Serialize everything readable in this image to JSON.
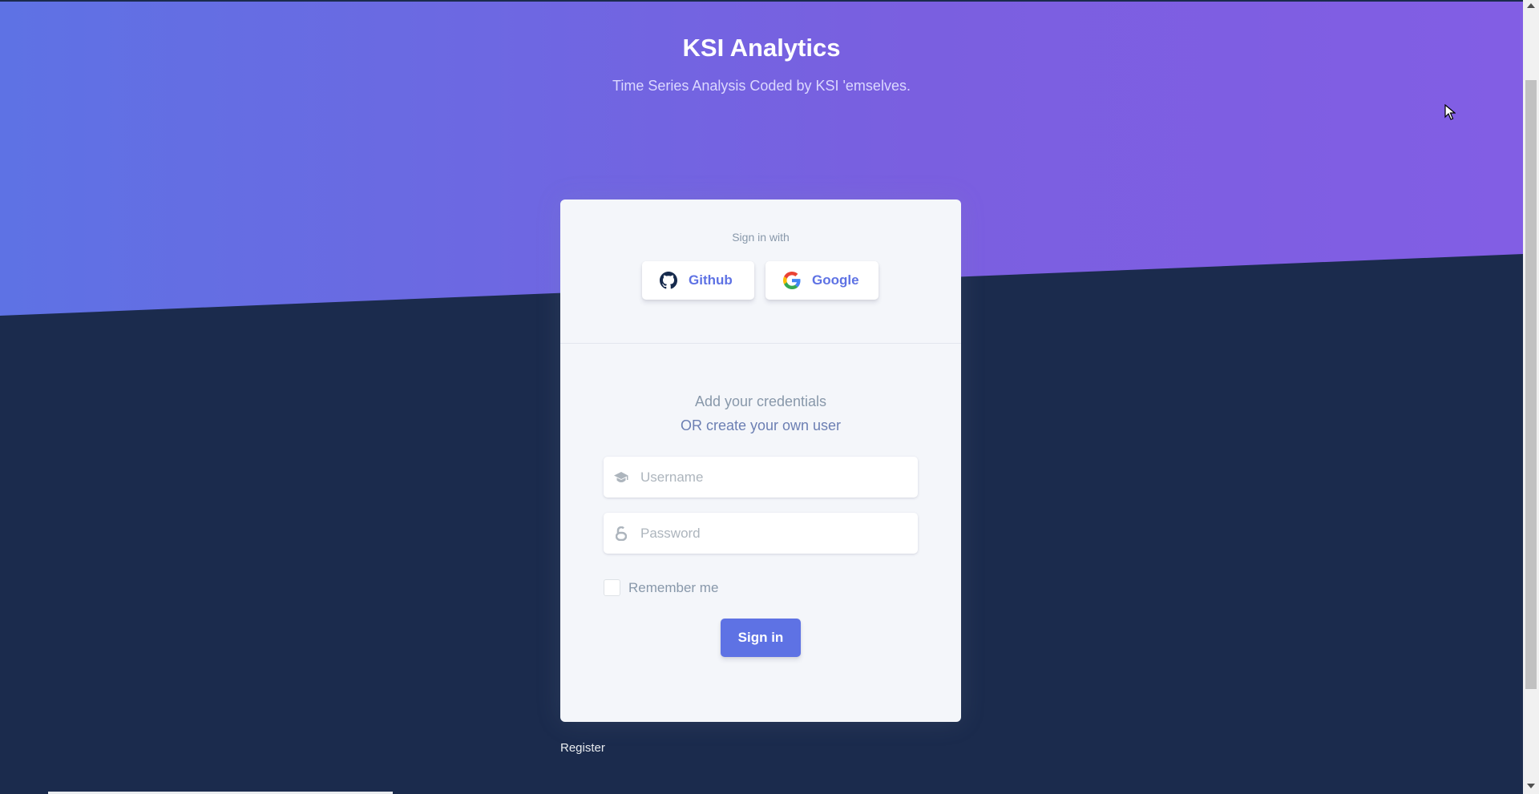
{
  "header": {
    "title": "KSI Analytics",
    "subtitle": "Time Series Analysis Coded by KSI 'emselves."
  },
  "social_login": {
    "label": "Sign in with",
    "github_label": "Github",
    "google_label": "Google"
  },
  "credentials": {
    "line1": "Add your credentials",
    "line2": "OR create your own user"
  },
  "form": {
    "username_placeholder": "Username",
    "password_placeholder": "Password",
    "remember_label": "Remember me",
    "submit_label": "Sign in"
  },
  "footer": {
    "register_label": "Register"
  },
  "colors": {
    "accent": "#5e72e4",
    "gradient_start": "#5e72e4",
    "gradient_end": "#825ee4",
    "background_dark": "#1b2b4d",
    "card_bg": "#f4f6fa"
  },
  "icons": {
    "github": "github-icon",
    "google": "google-icon",
    "username": "graduation-cap-icon",
    "password": "lock-icon"
  }
}
